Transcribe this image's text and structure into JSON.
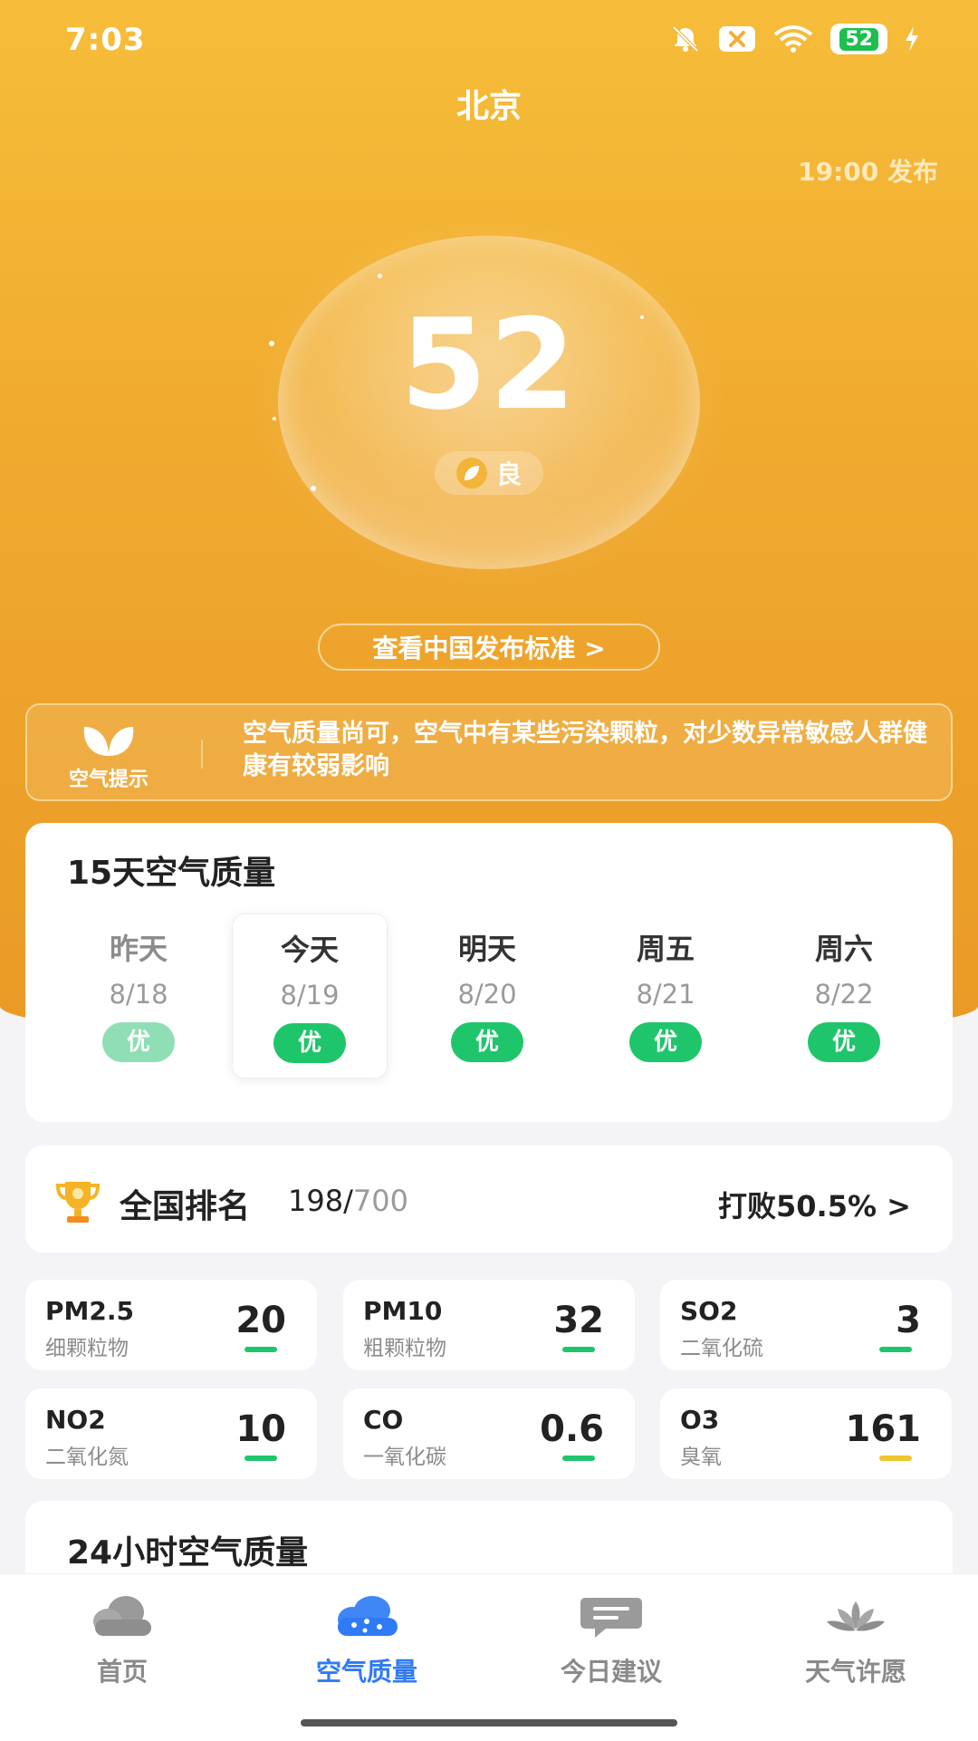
{
  "status_bar": {
    "time": "7:03",
    "battery": "52"
  },
  "header": {
    "city": "北京",
    "publish_time": "19:00 发布"
  },
  "aqi": {
    "value": "52",
    "level": "良",
    "standard_button": "查看中国发布标准 >"
  },
  "tip": {
    "label": "空气提示",
    "text": "空气质量尚可，空气中有某些污染颗粒，对少数异常敏感人群健康有较弱影响"
  },
  "forecast": {
    "title": "15天空气质量",
    "days": [
      {
        "name": "昨天",
        "date": "8/18",
        "level": "优"
      },
      {
        "name": "今天",
        "date": "8/19",
        "level": "优"
      },
      {
        "name": "明天",
        "date": "8/20",
        "level": "优"
      },
      {
        "name": "周五",
        "date": "8/21",
        "level": "优"
      },
      {
        "name": "周六",
        "date": "8/22",
        "level": "优"
      }
    ]
  },
  "ranking": {
    "title": "全国排名",
    "rank": "198/",
    "total": "700",
    "beat": "打败50.5% >"
  },
  "pollutants": [
    {
      "name": "PM2.5",
      "desc": "细颗粒物",
      "value": "20",
      "level_color": "#1fc56b"
    },
    {
      "name": "PM10",
      "desc": "粗颗粒物",
      "value": "32",
      "level_color": "#1fc56b"
    },
    {
      "name": "SO2",
      "desc": "二氧化硫",
      "value": "3",
      "level_color": "#1fc56b"
    },
    {
      "name": "NO2",
      "desc": "二氧化氮",
      "value": "10",
      "level_color": "#1fc56b"
    },
    {
      "name": "CO",
      "desc": "一氧化碳",
      "value": "0.6",
      "level_color": "#1fc56b"
    },
    {
      "name": "O3",
      "desc": "臭氧",
      "value": "161",
      "level_color": "#f0c42c"
    }
  ],
  "hourly": {
    "title": "24小时空气质量"
  },
  "tabbar": {
    "tabs": [
      {
        "label": "首页",
        "icon": "cloud-icon"
      },
      {
        "label": "空气质量",
        "icon": "air-quality-icon"
      },
      {
        "label": "今日建议",
        "icon": "chat-bubble-icon"
      },
      {
        "label": "天气许愿",
        "icon": "lotus-icon"
      }
    ],
    "active": "空气质量"
  }
}
